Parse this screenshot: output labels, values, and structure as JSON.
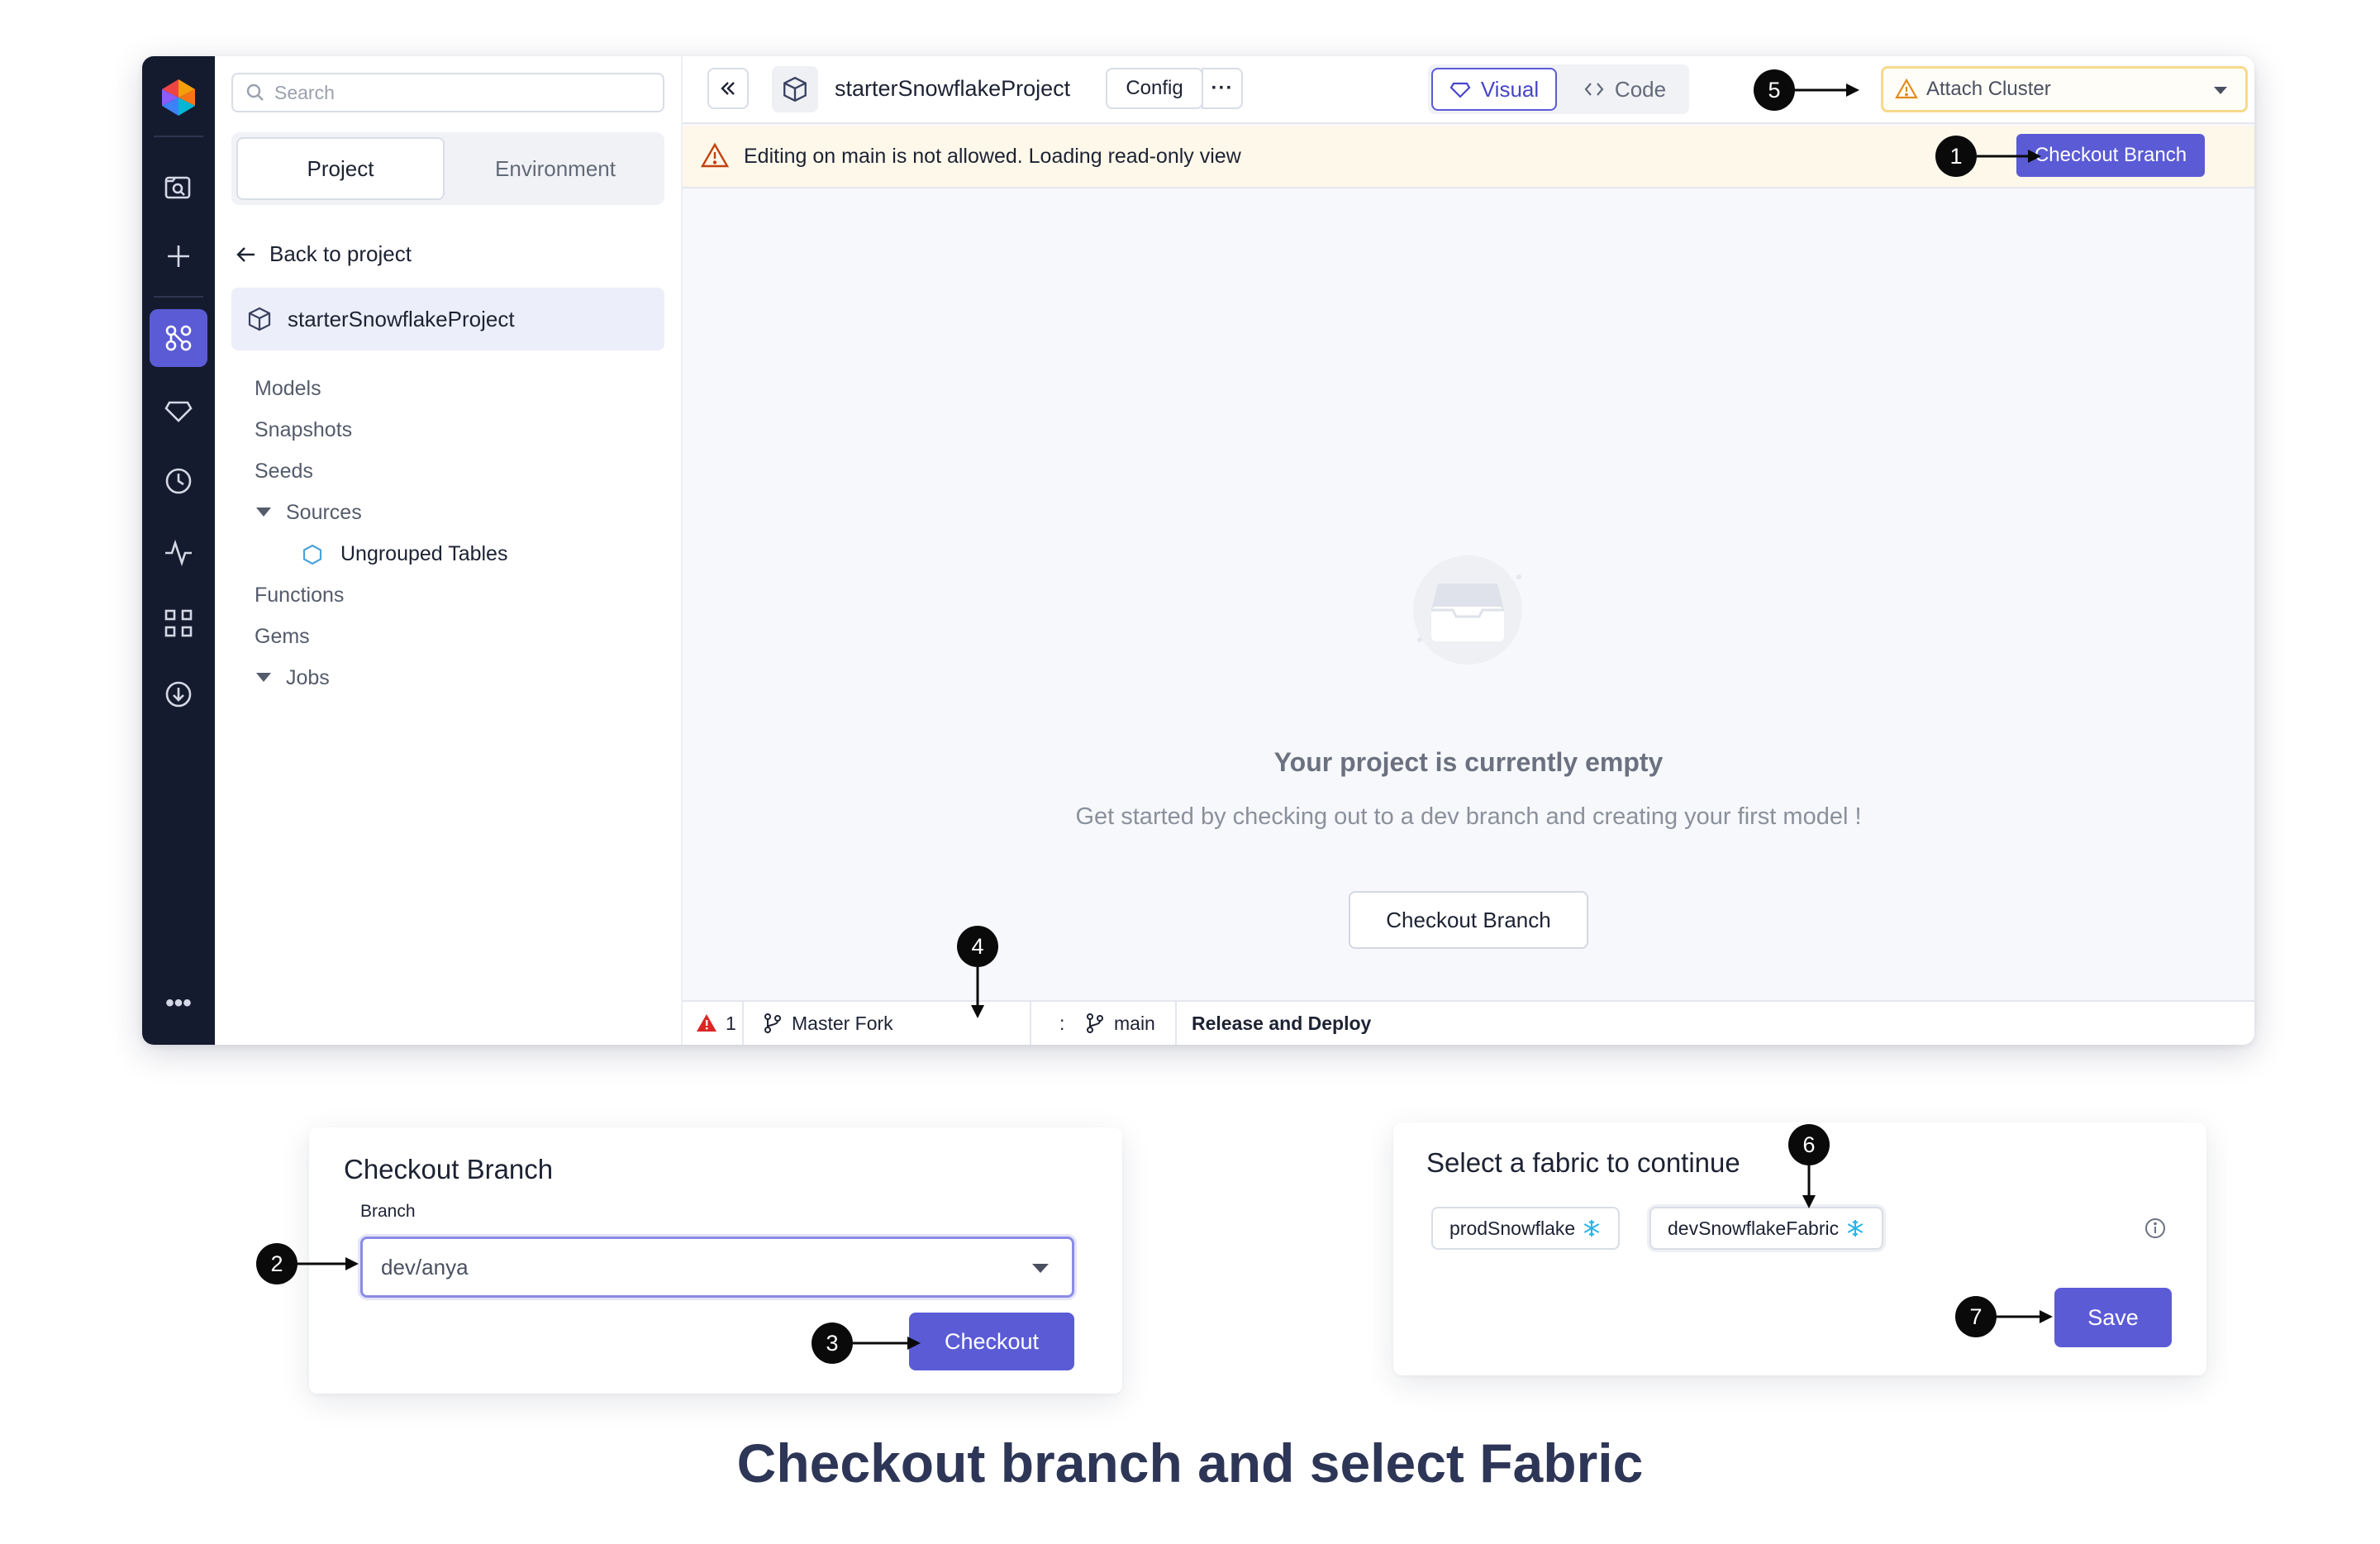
{
  "sidebar": {
    "search_placeholder": "Search",
    "tabs": [
      "Project",
      "Environment"
    ],
    "back_label": "Back to project",
    "project_name": "starterSnowflakeProject",
    "tree": {
      "models": "Models",
      "snapshots": "Snapshots",
      "seeds": "Seeds",
      "sources": "Sources",
      "ungrouped": "Ungrouped Tables",
      "functions": "Functions",
      "gems": "Gems",
      "jobs": "Jobs"
    }
  },
  "header": {
    "project_title": "starterSnowflakeProject",
    "config_label": "Config",
    "more_label": "···",
    "visual_label": "Visual",
    "code_label": "Code",
    "attach_cluster_label": "Attach Cluster"
  },
  "banner": {
    "message": "Editing on main is not allowed. Loading read-only view",
    "checkout_label": "Checkout Branch"
  },
  "empty_state": {
    "title": "Your project is currently empty",
    "subtitle": "Get started by checking out to a dev branch and creating your first model !",
    "checkout_label": "Checkout Branch"
  },
  "statusbar": {
    "error_count": "1",
    "fork_label": "Master Fork",
    "separator": ":",
    "branch_label": "main",
    "release_label": "Release and Deploy"
  },
  "checkout_dialog": {
    "title": "Checkout Branch",
    "branch_label": "Branch",
    "branch_value": "dev/anya",
    "checkout_button": "Checkout"
  },
  "fabric_dialog": {
    "title": "Select a fabric to continue",
    "fabrics": [
      "prodSnowflake",
      "devSnowflakeFabric"
    ],
    "save_button": "Save"
  },
  "callouts": [
    "1",
    "2",
    "3",
    "4",
    "5",
    "6",
    "7"
  ],
  "caption": "Checkout branch and select Fabric",
  "colors": {
    "accent": "#5b5bd6",
    "rail_bg": "#151b2e",
    "banner_bg": "#fdf8ea",
    "warning": "#c2410c",
    "error": "#dc2626",
    "snowflake": "#29b5e8"
  }
}
